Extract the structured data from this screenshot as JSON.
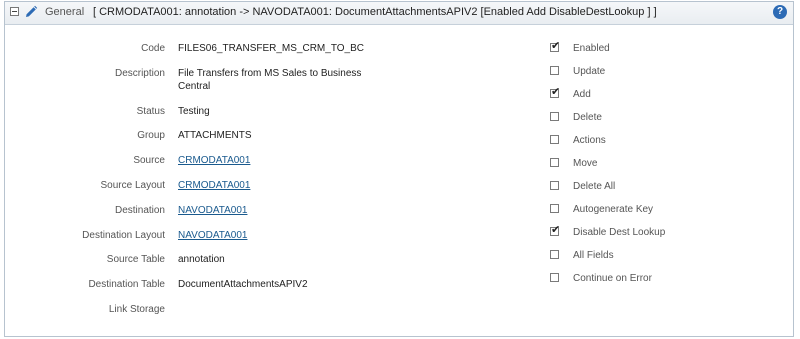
{
  "header": {
    "section": "General",
    "title": "[ CRMODATA001: annotation -> NAVODATA001: DocumentAttachmentsAPIV2 [Enabled Add DisableDestLookup ] ]"
  },
  "fields": [
    {
      "label": "Code",
      "value": "FILES06_TRANSFER_MS_CRM_TO_BC",
      "link": false
    },
    {
      "label": "Description",
      "value": "File Transfers from MS Sales to Business Central",
      "link": false
    },
    {
      "label": "Status",
      "value": "Testing",
      "link": false
    },
    {
      "label": "Group",
      "value": "ATTACHMENTS",
      "link": false
    },
    {
      "label": "Source",
      "value": "CRMODATA001",
      "link": true
    },
    {
      "label": "Source Layout",
      "value": "CRMODATA001",
      "link": true
    },
    {
      "label": "Destination",
      "value": "NAVODATA001",
      "link": true
    },
    {
      "label": "Destination Layout",
      "value": "NAVODATA001",
      "link": true
    },
    {
      "label": "Source Table",
      "value": "annotation",
      "link": false
    },
    {
      "label": "Destination Table",
      "value": "DocumentAttachmentsAPIV2",
      "link": false
    },
    {
      "label": "Link Storage",
      "value": "",
      "link": false
    }
  ],
  "options": [
    {
      "label": "Enabled",
      "checked": true
    },
    {
      "label": "Update",
      "checked": false
    },
    {
      "label": "Add",
      "checked": true
    },
    {
      "label": "Delete",
      "checked": false
    },
    {
      "label": "Actions",
      "checked": false
    },
    {
      "label": "Move",
      "checked": false
    },
    {
      "label": "Delete All",
      "checked": false
    },
    {
      "label": "Autogenerate Key",
      "checked": false
    },
    {
      "label": "Disable Dest Lookup",
      "checked": true
    },
    {
      "label": "All Fields",
      "checked": false
    },
    {
      "label": "Continue on Error",
      "checked": false
    }
  ],
  "icons": {
    "collapse": "collapse-icon",
    "edit": "pencil-icon",
    "help": "help-icon"
  },
  "colors": {
    "link": "#1a5a8e",
    "help": "#2d6bb5"
  }
}
